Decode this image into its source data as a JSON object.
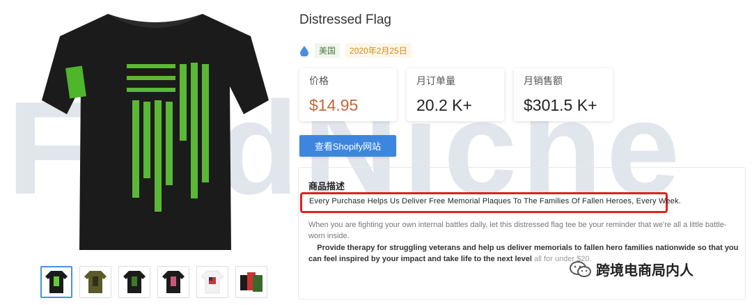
{
  "product": {
    "title": "Distressed Flag",
    "country": "美国",
    "date": "2020年2月25日"
  },
  "stats": [
    {
      "label": "价格",
      "value": "$14.95"
    },
    {
      "label": "月订单量",
      "value": "20.2 K+"
    },
    {
      "label": "月销售额",
      "value": "$301.5 K+"
    }
  ],
  "shop_button": "查看Shopify网站",
  "description": {
    "title": "商品描述",
    "highlight": "Every Purchase Helps Us Deliver Free Memorial Plaques To The Families Of Fallen Heroes, Every Week.",
    "para1": "When you are fighting your own internal battles daily, let this distressed flag tee be your reminder that we're all a little battle-worn inside.",
    "para2": "Provide therapy for struggling veterans and help us deliver memorials to fallen hero families nationwide so that you can feel inspired by your impact and take life to the next level",
    "para2_tail": " all for under $20."
  },
  "watermark_text": "FindNiche",
  "wechat_name": "跨境电商局内人",
  "colors": {
    "accent": "#3d86e0",
    "price": "#c0683c",
    "highlight_border": "#e02020",
    "shirt_print": "#6fd12a"
  }
}
